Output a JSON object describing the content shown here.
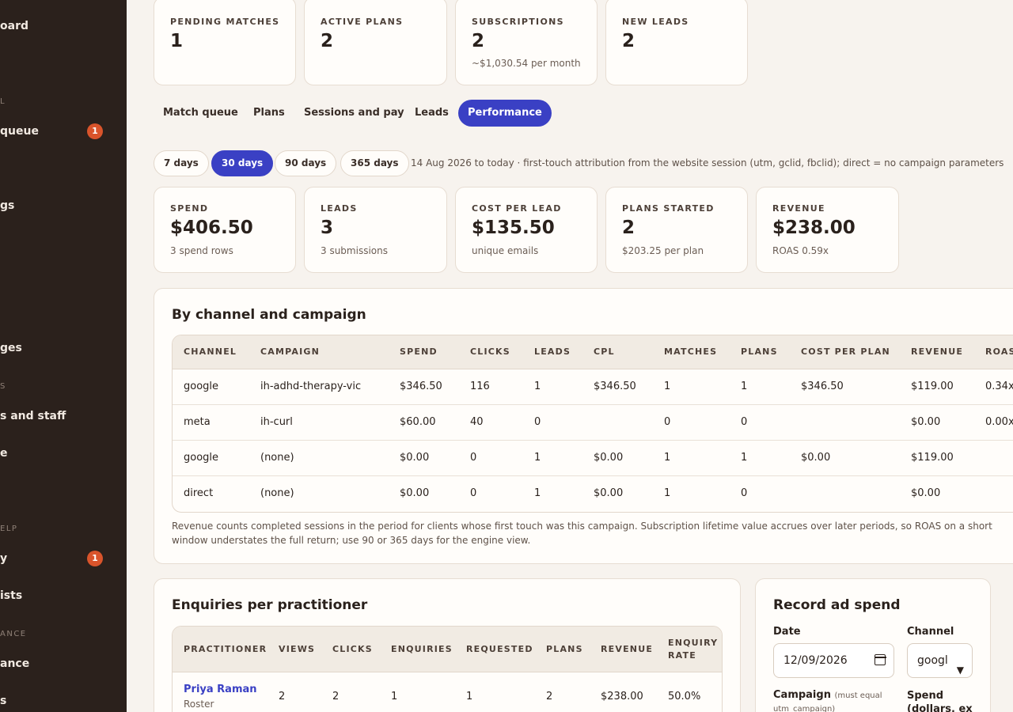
{
  "sidebar": {
    "items": [
      {
        "label": "oard",
        "top": 0
      },
      {
        "label": "queue"
      },
      {
        "label": "gs"
      },
      {
        "label": "ges"
      },
      {
        "label": "s and staff"
      },
      {
        "label": "e"
      },
      {
        "label": "y"
      },
      {
        "label": "ists"
      },
      {
        "label": "ance"
      },
      {
        "label": "s"
      }
    ],
    "sections": [
      "L",
      "S",
      "ELP",
      "ANCE"
    ],
    "badges": [
      "1",
      "1"
    ]
  },
  "summary": [
    {
      "label": "PENDING MATCHES",
      "value": "1",
      "sub": ""
    },
    {
      "label": "ACTIVE PLANS",
      "value": "2",
      "sub": ""
    },
    {
      "label": "SUBSCRIPTIONS",
      "value": "2",
      "sub": "~$1,030.54 per month"
    },
    {
      "label": "NEW LEADS",
      "value": "2",
      "sub": ""
    }
  ],
  "tabs": [
    "Match queue",
    "Plans",
    "Sessions and pay",
    "Leads",
    "Performance"
  ],
  "ranges": [
    "7 days",
    "30 days",
    "90 days",
    "365 days"
  ],
  "range_note": "14 Aug 2026 to today · first-touch attribution from the website session (utm, gclid, fbclid); direct = no campaign parameters",
  "kpis": [
    {
      "label": "SPEND",
      "value": "$406.50",
      "sub": "3 spend rows"
    },
    {
      "label": "LEADS",
      "value": "3",
      "sub": "3 submissions"
    },
    {
      "label": "COST PER LEAD",
      "value": "$135.50",
      "sub": "unique emails"
    },
    {
      "label": "PLANS STARTED",
      "value": "2",
      "sub": "$203.25 per plan"
    },
    {
      "label": "REVENUE",
      "value": "$238.00",
      "sub": "ROAS 0.59x"
    }
  ],
  "channel_table": {
    "title": "By channel and campaign",
    "headers": [
      "CHANNEL",
      "CAMPAIGN",
      "SPEND",
      "CLICKS",
      "LEADS",
      "CPL",
      "MATCHES",
      "PLANS",
      "COST PER PLAN",
      "REVENUE",
      "ROAS"
    ],
    "rows": [
      [
        "google",
        "ih-adhd-therapy-vic",
        "$346.50",
        "116",
        "1",
        "$346.50",
        "1",
        "1",
        "$346.50",
        "$119.00",
        "0.34x"
      ],
      [
        "meta",
        "ih-curl",
        "$60.00",
        "40",
        "0",
        "",
        "0",
        "0",
        "",
        "$0.00",
        "0.00x"
      ],
      [
        "google",
        "(none)",
        "$0.00",
        "0",
        "1",
        "$0.00",
        "1",
        "1",
        "$0.00",
        "$119.00",
        ""
      ],
      [
        "direct",
        "(none)",
        "$0.00",
        "0",
        "1",
        "$0.00",
        "1",
        "0",
        "",
        "$0.00",
        ""
      ]
    ],
    "footnote": "Revenue counts completed sessions in the period for clients whose first touch was this campaign. Subscription lifetime value accrues over later periods, so ROAS on a short window understates the full return; use 90 or 365 days for the engine view."
  },
  "practitioner_table": {
    "title": "Enquiries per practitioner",
    "headers": [
      "PRACTITIONER",
      "VIEWS",
      "CLICKS",
      "ENQUIRIES",
      "REQUESTED",
      "PLANS",
      "REVENUE",
      "ENQUIRY"
    ],
    "header_last_line2": "RATE",
    "rows": [
      {
        "name": "Priya Raman",
        "sub": "Roster",
        "cells": [
          "2",
          "2",
          "1",
          "1",
          "2",
          "$238.00",
          "50.0%"
        ]
      }
    ]
  },
  "ad_spend": {
    "title": "Record ad spend",
    "date_label": "Date",
    "date_value": "12/09/2026",
    "channel_label": "Channel",
    "channel_value": "googl",
    "campaign_label": "Campaign",
    "campaign_hint": "(must equal",
    "campaign_hint2": "utm_campaign)",
    "spend_label": "Spend",
    "spend_label2": "(dollars, ex"
  }
}
